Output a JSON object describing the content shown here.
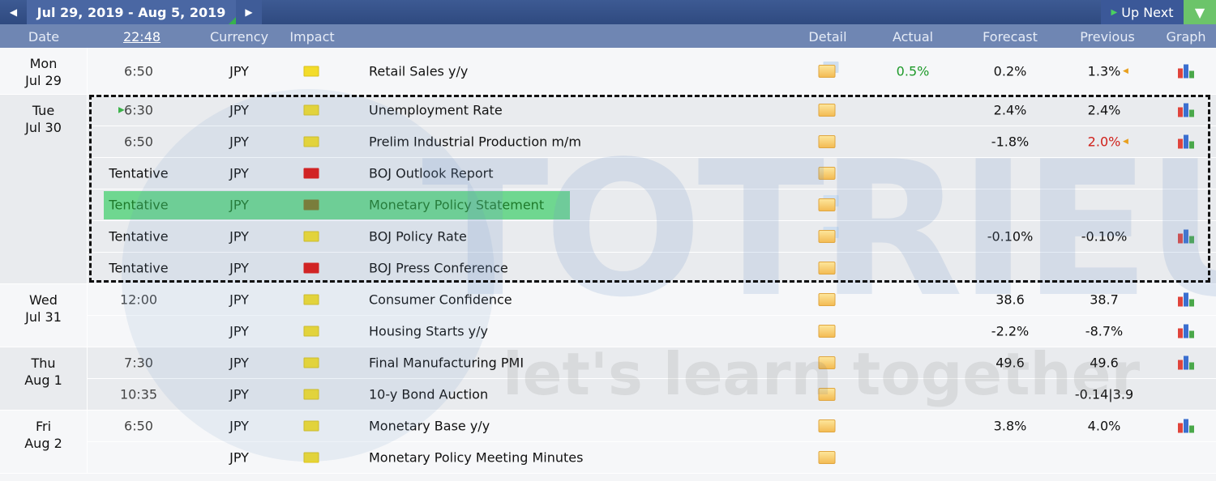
{
  "header": {
    "date_range": "Jul 29, 2019 - Aug 5, 2019",
    "up_next": "Up Next",
    "prev_icon": "chevron-left-icon",
    "next_icon": "chevron-right-icon",
    "filter_icon": "filter-icon"
  },
  "columns": {
    "date": "Date",
    "time": "22:48",
    "currency": "Currency",
    "impact": "Impact",
    "detail": "Detail",
    "actual": "Actual",
    "forecast": "Forecast",
    "previous": "Previous",
    "graph": "Graph"
  },
  "watermark": {
    "brand": "TOTRIEU",
    "tagline": "let's learn together"
  },
  "colors": {
    "accent": "#3d5a93",
    "actual_better": "#1e9a2a",
    "previous_revised_worse": "#d0201a",
    "impact_low": "#f3dc2a",
    "impact_high": "#e0140e",
    "highlight": "#5fd08a"
  },
  "days": [
    {
      "weekday": "Mon",
      "date": "Jul 29",
      "events": [
        {
          "time": "6:50",
          "currency": "JPY",
          "impact": "low",
          "event": "Retail Sales y/y",
          "detail": "folder-doc",
          "actual": "0.5%",
          "forecast": "0.2%",
          "previous": "1.3%",
          "previous_marker": "revised",
          "previous_color": "normal",
          "graph": true
        }
      ]
    },
    {
      "weekday": "Tue",
      "date": "Jul 30",
      "events": [
        {
          "time": "6:30",
          "upnext": true,
          "currency": "JPY",
          "impact": "low",
          "event": "Unemployment Rate",
          "detail": "folder",
          "actual": "",
          "forecast": "2.4%",
          "previous": "2.4%",
          "graph": true
        },
        {
          "time": "6:50",
          "currency": "JPY",
          "impact": "low",
          "event": "Prelim Industrial Production m/m",
          "detail": "folder",
          "actual": "",
          "forecast": "-1.8%",
          "previous": "2.0%",
          "previous_marker": "revised",
          "previous_color": "worse",
          "graph": true
        },
        {
          "time": "Tentative",
          "currency": "JPY",
          "impact": "high",
          "event": "BOJ Outlook Report",
          "detail": "folder",
          "actual": "",
          "forecast": "",
          "previous": "",
          "graph": false
        },
        {
          "time": "Tentative",
          "currency": "JPY",
          "impact": "high",
          "event": "Monetary Policy Statement",
          "detail": "folder-doc",
          "actual": "",
          "forecast": "",
          "previous": "",
          "graph": false,
          "highlighted": true
        },
        {
          "time": "Tentative",
          "currency": "JPY",
          "impact": "low",
          "event": "BOJ Policy Rate",
          "detail": "folder-doc",
          "actual": "",
          "forecast": "-0.10%",
          "previous": "-0.10%",
          "graph": true
        },
        {
          "time": "Tentative",
          "currency": "JPY",
          "impact": "high",
          "event": "BOJ Press Conference",
          "detail": "folder",
          "actual": "",
          "forecast": "",
          "previous": "",
          "graph": false
        }
      ]
    },
    {
      "weekday": "Wed",
      "date": "Jul 31",
      "events": [
        {
          "time": "12:00",
          "currency": "JPY",
          "impact": "low",
          "event": "Consumer Confidence",
          "detail": "folder",
          "actual": "",
          "forecast": "38.6",
          "previous": "38.7",
          "graph": true
        },
        {
          "time": "",
          "currency": "JPY",
          "impact": "low",
          "event": "Housing Starts y/y",
          "detail": "folder",
          "actual": "",
          "forecast": "-2.2%",
          "previous": "-8.7%",
          "graph": true
        }
      ]
    },
    {
      "weekday": "Thu",
      "date": "Aug 1",
      "events": [
        {
          "time": "7:30",
          "currency": "JPY",
          "impact": "low",
          "event": "Final Manufacturing PMI",
          "detail": "folder",
          "actual": "",
          "forecast": "49.6",
          "previous": "49.6",
          "graph": true
        },
        {
          "time": "10:35",
          "currency": "JPY",
          "impact": "low",
          "event": "10-y Bond Auction",
          "detail": "folder",
          "actual": "",
          "forecast": "",
          "previous": "-0.14|3.9",
          "graph": false
        }
      ]
    },
    {
      "weekday": "Fri",
      "date": "Aug 2",
      "events": [
        {
          "time": "6:50",
          "currency": "JPY",
          "impact": "low",
          "event": "Monetary Base y/y",
          "detail": "folder",
          "actual": "",
          "forecast": "3.8%",
          "previous": "4.0%",
          "graph": true
        },
        {
          "time": "",
          "currency": "JPY",
          "impact": "low",
          "event": "Monetary Policy Meeting Minutes",
          "detail": "folder",
          "actual": "",
          "forecast": "",
          "previous": "",
          "graph": false
        }
      ]
    }
  ]
}
